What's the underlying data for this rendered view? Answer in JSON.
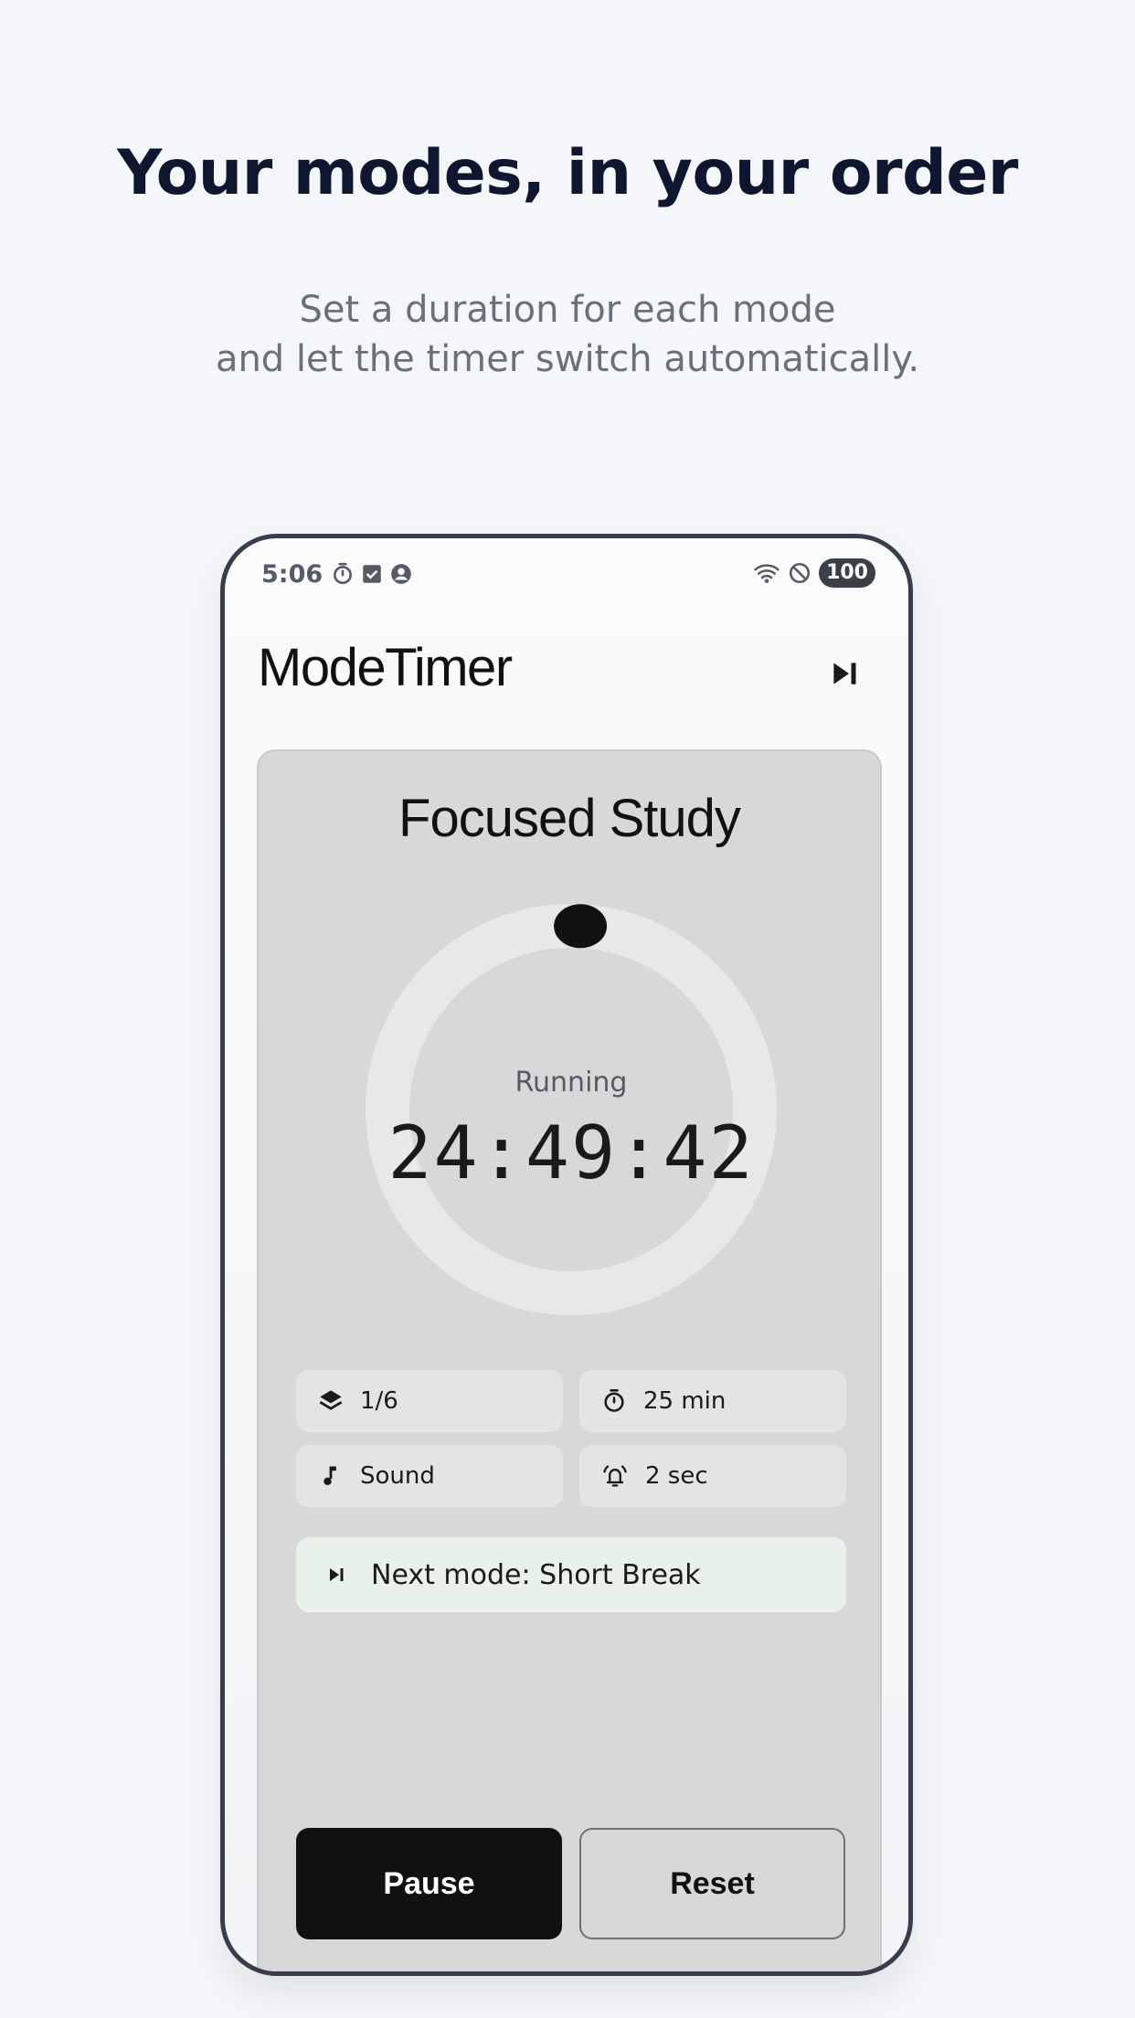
{
  "promo": {
    "headline": "Your modes, in your order",
    "subline_1": "Set a duration for each mode",
    "subline_2": "and let the timer switch automatically."
  },
  "status_bar": {
    "time": "5:06",
    "battery": "100",
    "left_icons": [
      "stopwatch-icon",
      "checkbox-icon",
      "account-circle-icon"
    ],
    "right_icons": [
      "wifi-icon",
      "do-not-disturb-icon"
    ]
  },
  "app": {
    "title": "ModeTimer",
    "skip_icon": "skip-next-icon"
  },
  "timer": {
    "mode_name": "Focused Study",
    "state": "Running",
    "remaining": "24:49:42",
    "progress_fraction": 0.008
  },
  "chips": {
    "mode_index": "1/6",
    "duration": "25 min",
    "sound": "Sound",
    "alert_duration": "2 sec"
  },
  "next_mode": {
    "label": "Next mode: Short Break"
  },
  "controls": {
    "pause_label": "Pause",
    "reset_label": "Reset"
  },
  "colors": {
    "background": "#f4f6fa",
    "card": "#d8d8d9",
    "ring_track": "#e8e8ea",
    "ring_knob": "#111111",
    "next_banner": "#e9f2ea",
    "primary_button": "#111111"
  }
}
